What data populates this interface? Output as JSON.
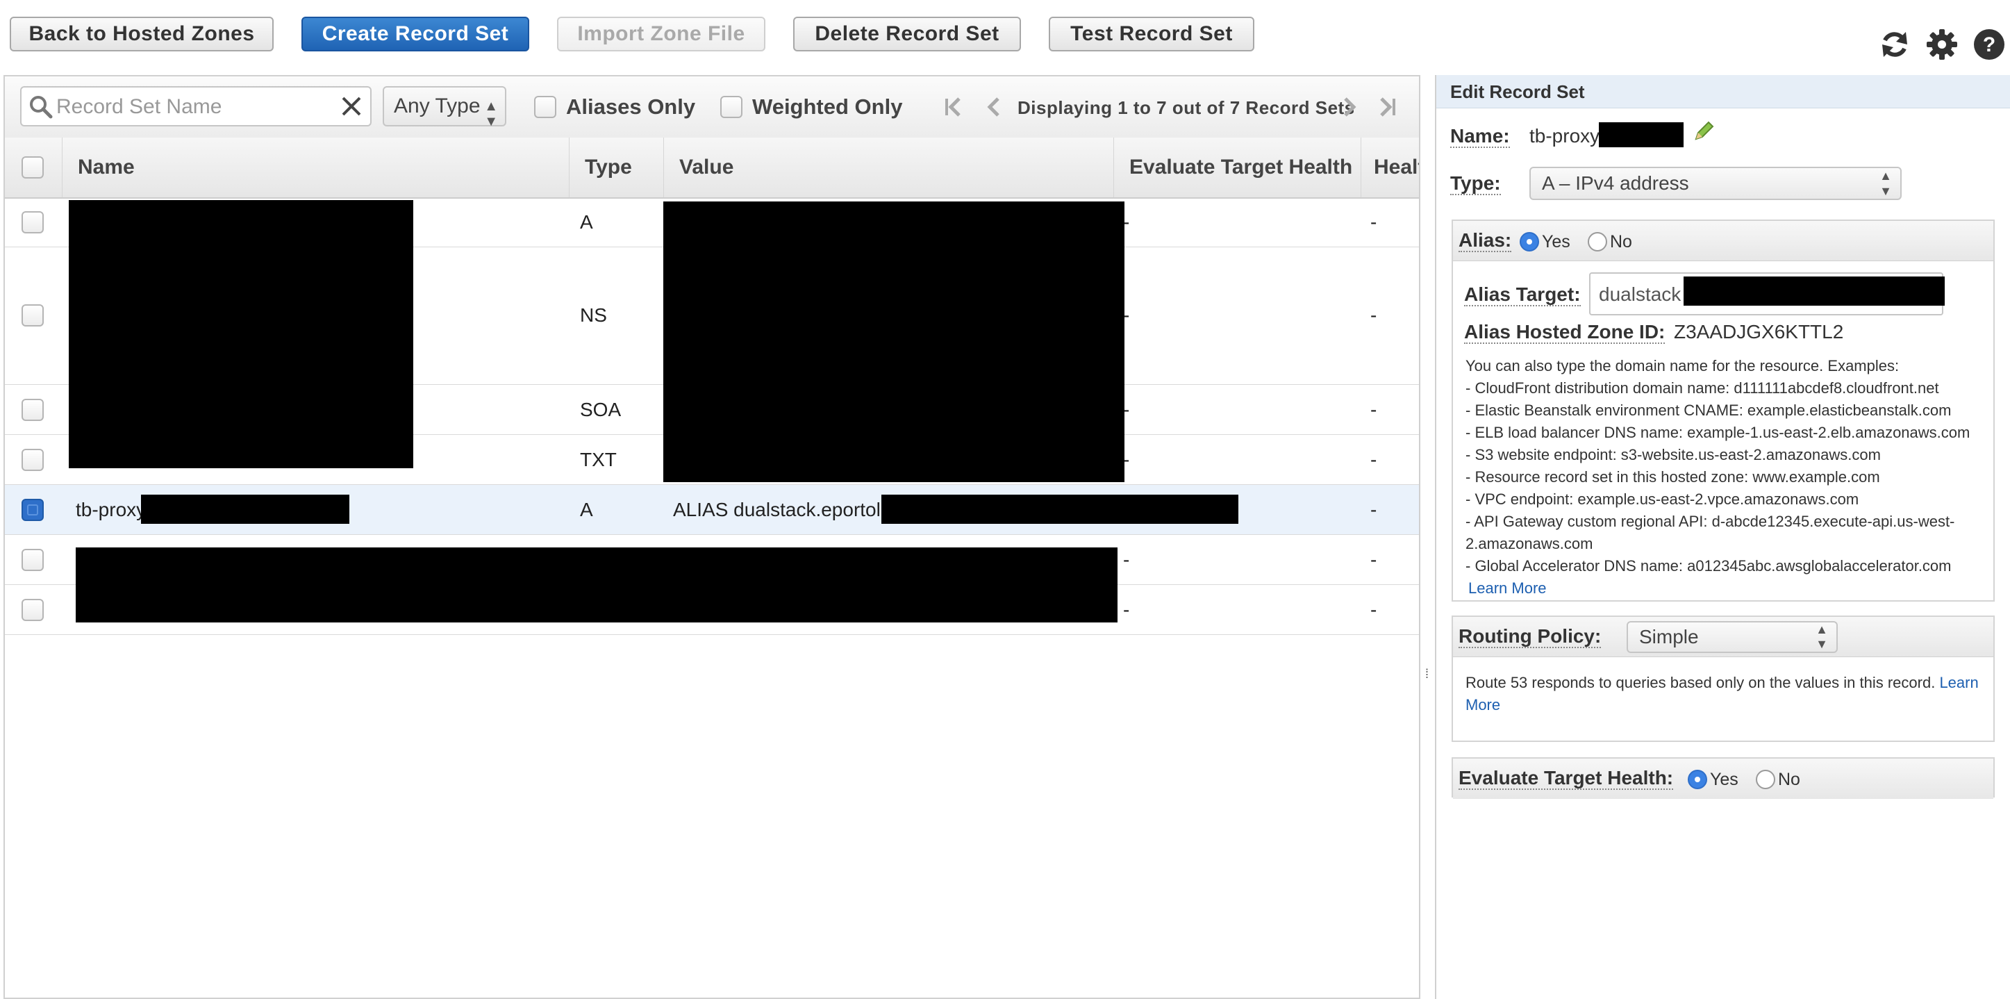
{
  "toolbar": {
    "back": "Back to Hosted Zones",
    "create": "Create Record Set",
    "import": "Import Zone File",
    "delete": "Delete Record Set",
    "test": "Test Record Set"
  },
  "filters": {
    "search_placeholder": "Record Set Name",
    "type_select": "Any Type",
    "aliases_only": "Aliases Only",
    "weighted_only": "Weighted Only",
    "pager": "Displaying 1 to 7 out of 7 Record Sets"
  },
  "table": {
    "columns": [
      "Name",
      "Type",
      "Value",
      "Evaluate Target Health",
      "Healt"
    ],
    "rows": [
      {
        "name": "",
        "type": "A",
        "value": "",
        "eval": "-",
        "health": "-"
      },
      {
        "name": "",
        "type": "NS",
        "value": "",
        "eval": "-",
        "health": "-"
      },
      {
        "name": "",
        "type": "SOA",
        "value": "",
        "eval": "-",
        "health": "-"
      },
      {
        "name": "",
        "type": "TXT",
        "value": "",
        "eval": "-",
        "health": "-"
      },
      {
        "name": "tb-proxy",
        "type": "A",
        "value": "ALIAS dualstack.eportolar",
        "eval": "",
        "health": "-"
      },
      {
        "name": "",
        "type": "",
        "value": "",
        "eval": "-",
        "health": "-"
      },
      {
        "name": "",
        "type": "",
        "value": "",
        "eval": "-",
        "health": "-"
      }
    ]
  },
  "edit": {
    "header": "Edit Record Set",
    "name_label": "Name:",
    "name_value": "tb-proxy",
    "type_label": "Type:",
    "type_value": "A – IPv4 address",
    "alias_label": "Alias:",
    "yes": "Yes",
    "no": "No",
    "alias_target_label": "Alias Target:",
    "alias_target_value": "dualstack",
    "alias_zone_label": "Alias Hosted Zone ID:",
    "alias_zone_value": "Z3AADJGX6KTTL2",
    "help_intro": "You can also type the domain name for the resource. Examples:",
    "help_items": [
      "-  CloudFront distribution domain name: d111111abcdef8.cloudfront.net",
      "-  Elastic Beanstalk environment CNAME: example.elasticbeanstalk.com",
      "-  ELB load balancer DNS name: example-1.us-east-2.elb.amazonaws.com",
      "-  S3 website endpoint: s3-website.us-east-2.amazonaws.com",
      "-  Resource record set in this hosted zone: www.example.com",
      "-  VPC endpoint: example.us-east-2.vpce.amazonaws.com",
      "-  API Gateway custom regional API: d-abcde12345.execute-api.us-west-",
      "2.amazonaws.com",
      "-  Global Accelerator DNS name: a012345abc.awsglobalaccelerator.com"
    ],
    "learn_more": "Learn More",
    "routing_label": "Routing Policy:",
    "routing_value": "Simple",
    "routing_help": "Route 53 responds to queries based only on the values in this record.",
    "routing_learn": "Learn",
    "routing_more": "More",
    "eval_label": "Evaluate Target Health:"
  },
  "colors": {
    "primary": "#2a72c2",
    "selected_row": "#eaf2fb",
    "panel_header": "#e6eef7"
  },
  "icons": [
    "refresh-icon",
    "gear-icon",
    "help-icon",
    "search-icon",
    "clear-icon",
    "pencil-icon"
  ]
}
